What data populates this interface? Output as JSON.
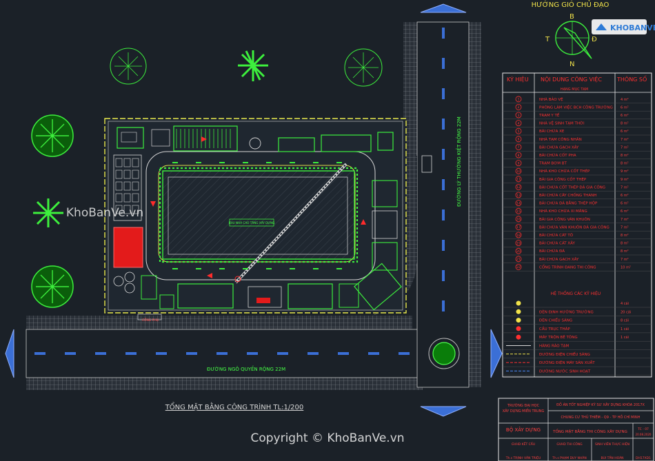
{
  "compass": {
    "title": "HƯỚNG GIÓ CHỦ ĐẠO",
    "north": "B",
    "south": "N",
    "west": "T",
    "east": "Đ"
  },
  "watermark": {
    "logo_text": "KHOBANVE",
    "mid_text": "KhoBanVe.vn",
    "copyright": "Copyright © KhoBanVe.vn"
  },
  "roads": {
    "horizontal_label": "ĐƯỜNG NGÔ QUYỀN RỘNG 22M",
    "vertical_label": "ĐƯỜNG LÝ THƯỜNG KIỆT RỘNG 22M",
    "gate_label": "CỔNG PHỤ"
  },
  "plan": {
    "title": "TỔNG MẶT BẰNG CÔNG TRÌNH TL:1/200",
    "building_label": "KHU NHÀ CAO TẦNG XÂY DỰNG"
  },
  "legend": {
    "col_symbol": "KÝ HIỆU",
    "col_content": "NỘI DUNG CÔNG VIỆC",
    "col_param": "THÔNG SỐ",
    "section_temp": "HẠNG MỤC TẠM",
    "section_systems": "HỆ THỐNG CÁC KỸ HIỆU",
    "items": [
      {
        "sym": "1",
        "label": "NHÀ BẢO VỆ",
        "val": "4 m²"
      },
      {
        "sym": "2",
        "label": "PHÒNG LÀM VIỆC BCH CÔNG TRƯỜNG",
        "val": "6 m²"
      },
      {
        "sym": "3",
        "label": "TRẠM Y TẾ",
        "val": "6 m²"
      },
      {
        "sym": "4",
        "label": "NHÀ VỆ SINH TẠM THỜI",
        "val": "8 m²"
      },
      {
        "sym": "5",
        "label": "BÃI CHỨA XE",
        "val": "6 m²"
      },
      {
        "sym": "6",
        "label": "NHÀ TẠM CÔNG NHÂN",
        "val": "7 m²"
      },
      {
        "sym": "7",
        "label": "BÃI CHỨA GẠCH XÂY",
        "val": "7 m²"
      },
      {
        "sym": "8",
        "label": "BÃI CHỨA CỐT PHA",
        "val": "8 m²"
      },
      {
        "sym": "9",
        "label": "TRẠM BƠM BT",
        "val": "8 m²"
      },
      {
        "sym": "10",
        "label": "NHÀ KHO CHỨA CỐT THÉP",
        "val": "9 m²"
      },
      {
        "sym": "11",
        "label": "BÃI GIA CÔNG CỐT THÉP",
        "val": "9 m²"
      },
      {
        "sym": "12",
        "label": "BÃI CHỨA CỐT THÉP ĐÃ GIA CÔNG",
        "val": "7 m²"
      },
      {
        "sym": "13",
        "label": "BÃI CHỨA CÂY CHỐNG THANH",
        "val": "6 m²"
      },
      {
        "sym": "14",
        "label": "BÃI CHỨA ĐÁ BẰNG THÉP HỘP",
        "val": "6 m²"
      },
      {
        "sym": "15",
        "label": "NHÀ KHO CHỨA XI MĂNG",
        "val": "6 m²"
      },
      {
        "sym": "16",
        "label": "BÃI GIA CÔNG VÁN KHUÔN",
        "val": "7 m²"
      },
      {
        "sym": "17",
        "label": "BÃI CHỨA VÁN KHUÔN ĐÃ GIA CÔNG",
        "val": "7 m²"
      },
      {
        "sym": "18",
        "label": "BÃI CHỨA CÁT TÔ",
        "val": "8 m²"
      },
      {
        "sym": "19",
        "label": "BÃI CHỨA CÁT XÂY",
        "val": "8 m²"
      },
      {
        "sym": "20",
        "label": "BÃI CHỨA ĐÁ",
        "val": "8 m²"
      },
      {
        "sym": "21",
        "label": "BÃI CHỨA GẠCH XÂY",
        "val": "7 m²"
      },
      {
        "sym": "22",
        "label": "CỔNG TRÌNH ĐANG THI CÔNG",
        "val": "10 m²"
      }
    ],
    "systems": [
      {
        "sym": "bulb",
        "label": "",
        "val": "4 cái"
      },
      {
        "sym": "light",
        "label": "ĐÈN ĐỊNH HƯỚNG TRƯỜNG",
        "val": "20 cái"
      },
      {
        "sym": "lamp",
        "label": "ĐÈN CHIẾU SÁNG",
        "val": "8 cái"
      },
      {
        "sym": "crane",
        "label": "CẦU TRỤC THÁP",
        "val": "1 cái"
      },
      {
        "sym": "mixer",
        "label": "MÁY TRỘN BÊ TÔNG",
        "val": "1 cái"
      },
      {
        "sym": "fence",
        "label": "HÀNG RÀO TẠM",
        "val": ""
      },
      {
        "sym": "line-s",
        "label": "ĐƯỜNG ĐIỆN CHIẾU SÁNG",
        "val": ""
      },
      {
        "sym": "line-w",
        "label": "ĐƯỜNG ĐIỆN MÁY SẢN XUẤT",
        "val": ""
      },
      {
        "sym": "line-n",
        "label": "ĐƯỜNG NƯỚC SINH HOẠT",
        "val": ""
      }
    ]
  },
  "title_block": {
    "school_line1": "TRƯỜNG ĐẠI HỌC",
    "school_line2": "XÂY DỰNG MIỀN TRUNG",
    "project_line1": "ĐỒ ÁN TỐT NGHIỆP KỸ SƯ XÂY DỰNG KHÓA 2017X",
    "project_line2": "CHUNG CƯ THỦ THIÊM - Q9 - TP HỒ CHÍ MINH",
    "ministry": "BỘ XÂY DỰNG",
    "drawing_name": "TỔNG MẶT BẰNG THI CÔNG XÂY DỰNG",
    "gvhd_kc": "GVHD KẾT CẤU",
    "gvhd_tc": "GVHD THI CÔNG",
    "sv": "SINH VIÊN THỰC HIỆN",
    "sheet": "TC - 07",
    "date": "20.08.2020",
    "name1": "Th.s TRỊNH VĂN TRIỆU",
    "name2": "Th.s PHẠM DUY NHÂN",
    "name3": "BÙI TẤN HOÀN",
    "class": "DH17XD1"
  }
}
